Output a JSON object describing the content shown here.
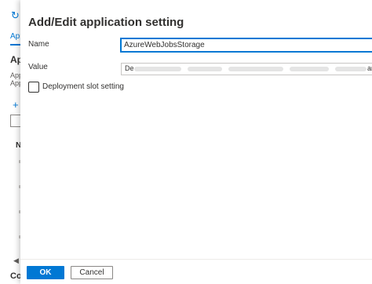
{
  "background": {
    "refresh_icon": "refresh-icon",
    "tab_label": "Appl",
    "heading": "Ap",
    "desc_line1": "App",
    "desc_line2": "App",
    "add_icon": "plus-icon",
    "column_header": "N",
    "scroll_icon": "chevron-left-icon",
    "footer_heading": "Co"
  },
  "dialog": {
    "title": "Add/Edit application setting",
    "name_label": "Name",
    "name_value": "AzureWebJobsStorage",
    "value_label": "Value",
    "value_prefix": "De",
    "value_suffix": "ann",
    "deployment_slot_label": "Deployment slot setting",
    "deployment_slot_checked": false
  },
  "buttons": {
    "ok_label": "OK",
    "cancel_label": "Cancel"
  },
  "colors": {
    "accent": "#0078d4",
    "text": "#323130"
  }
}
